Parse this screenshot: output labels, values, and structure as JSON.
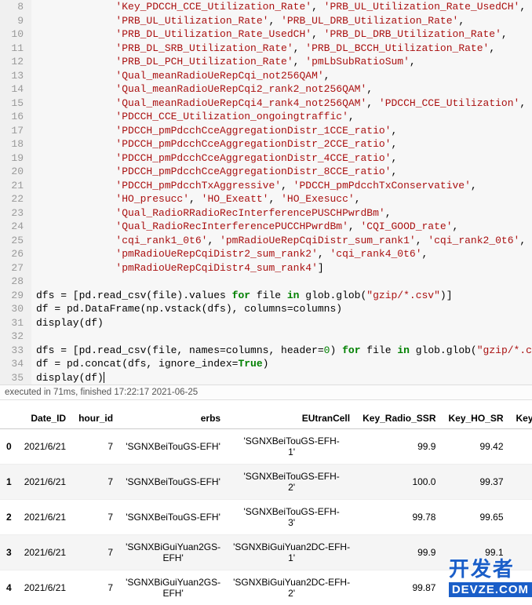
{
  "code_lines": [
    {
      "n": 8,
      "indent": "             ",
      "tokens": [
        {
          "t": "str",
          "v": "'Key_PDCCH_CCE_Utilization_Rate'"
        },
        {
          "t": "p",
          "v": ", "
        },
        {
          "t": "str",
          "v": "'PRB_UL_Utilization_Rate_UsedCH'"
        },
        {
          "t": "p",
          "v": ","
        }
      ]
    },
    {
      "n": 9,
      "indent": "             ",
      "tokens": [
        {
          "t": "str",
          "v": "'PRB_UL_Utilization_Rate'"
        },
        {
          "t": "p",
          "v": ", "
        },
        {
          "t": "str",
          "v": "'PRB_UL_DRB_Utilization_Rate'"
        },
        {
          "t": "p",
          "v": ","
        }
      ]
    },
    {
      "n": 10,
      "indent": "             ",
      "tokens": [
        {
          "t": "str",
          "v": "'PRB_DL_Utilization_Rate_UsedCH'"
        },
        {
          "t": "p",
          "v": ", "
        },
        {
          "t": "str",
          "v": "'PRB_DL_DRB_Utilization_Rate'"
        },
        {
          "t": "p",
          "v": ","
        }
      ]
    },
    {
      "n": 11,
      "indent": "             ",
      "tokens": [
        {
          "t": "str",
          "v": "'PRB_DL_SRB_Utilization_Rate'"
        },
        {
          "t": "p",
          "v": ", "
        },
        {
          "t": "str",
          "v": "'PRB_DL_BCCH_Utilization_Rate'"
        },
        {
          "t": "p",
          "v": ","
        }
      ]
    },
    {
      "n": 12,
      "indent": "             ",
      "tokens": [
        {
          "t": "str",
          "v": "'PRB_DL_PCH_Utilization_Rate'"
        },
        {
          "t": "p",
          "v": ", "
        },
        {
          "t": "str",
          "v": "'pmLbSubRatioSum'"
        },
        {
          "t": "p",
          "v": ","
        }
      ]
    },
    {
      "n": 13,
      "indent": "             ",
      "tokens": [
        {
          "t": "str",
          "v": "'Qual_meanRadioUeRepCqi_not256QAM'"
        },
        {
          "t": "p",
          "v": ","
        }
      ]
    },
    {
      "n": 14,
      "indent": "             ",
      "tokens": [
        {
          "t": "str",
          "v": "'Qual_meanRadioUeRepCqi2_rank2_not256QAM'"
        },
        {
          "t": "p",
          "v": ","
        }
      ]
    },
    {
      "n": 15,
      "indent": "             ",
      "tokens": [
        {
          "t": "str",
          "v": "'Qual_meanRadioUeRepCqi4_rank4_not256QAM'"
        },
        {
          "t": "p",
          "v": ", "
        },
        {
          "t": "str",
          "v": "'PDCCH_CCE_Utilization'"
        },
        {
          "t": "p",
          "v": ","
        }
      ]
    },
    {
      "n": 16,
      "indent": "             ",
      "tokens": [
        {
          "t": "str",
          "v": "'PDCCH_CCE_Utilization_ongoingtraffic'"
        },
        {
          "t": "p",
          "v": ","
        }
      ]
    },
    {
      "n": 17,
      "indent": "             ",
      "tokens": [
        {
          "t": "str",
          "v": "'PDCCH_pmPdcchCceAggregationDistr_1CCE_ratio'"
        },
        {
          "t": "p",
          "v": ","
        }
      ]
    },
    {
      "n": 18,
      "indent": "             ",
      "tokens": [
        {
          "t": "str",
          "v": "'PDCCH_pmPdcchCceAggregationDistr_2CCE_ratio'"
        },
        {
          "t": "p",
          "v": ","
        }
      ]
    },
    {
      "n": 19,
      "indent": "             ",
      "tokens": [
        {
          "t": "str",
          "v": "'PDCCH_pmPdcchCceAggregationDistr_4CCE_ratio'"
        },
        {
          "t": "p",
          "v": ","
        }
      ]
    },
    {
      "n": 20,
      "indent": "             ",
      "tokens": [
        {
          "t": "str",
          "v": "'PDCCH_pmPdcchCceAggregationDistr_8CCE_ratio'"
        },
        {
          "t": "p",
          "v": ","
        }
      ]
    },
    {
      "n": 21,
      "indent": "             ",
      "tokens": [
        {
          "t": "str",
          "v": "'PDCCH_pmPdcchTxAggressive'"
        },
        {
          "t": "p",
          "v": ", "
        },
        {
          "t": "str",
          "v": "'PDCCH_pmPdcchTxConservative'"
        },
        {
          "t": "p",
          "v": ","
        }
      ]
    },
    {
      "n": 22,
      "indent": "             ",
      "tokens": [
        {
          "t": "str",
          "v": "'HO_presucc'"
        },
        {
          "t": "p",
          "v": ", "
        },
        {
          "t": "str",
          "v": "'HO_Exeatt'"
        },
        {
          "t": "p",
          "v": ", "
        },
        {
          "t": "str",
          "v": "'HO_Exesucc'"
        },
        {
          "t": "p",
          "v": ","
        }
      ]
    },
    {
      "n": 23,
      "indent": "             ",
      "tokens": [
        {
          "t": "str",
          "v": "'Qual_RadioRRadioRecInterferencePUSCHPwrdBm'"
        },
        {
          "t": "p",
          "v": ","
        }
      ]
    },
    {
      "n": 24,
      "indent": "             ",
      "tokens": [
        {
          "t": "str",
          "v": "'Qual_RadioRecInterferencePUCCHPwrdBm'"
        },
        {
          "t": "p",
          "v": ", "
        },
        {
          "t": "str",
          "v": "'CQI_GOOD_rate'"
        },
        {
          "t": "p",
          "v": ","
        }
      ]
    },
    {
      "n": 25,
      "indent": "             ",
      "tokens": [
        {
          "t": "str",
          "v": "'cqi_rank1_0t6'"
        },
        {
          "t": "p",
          "v": ", "
        },
        {
          "t": "str",
          "v": "'pmRadioUeRepCqiDistr_sum_rank1'"
        },
        {
          "t": "p",
          "v": ", "
        },
        {
          "t": "str",
          "v": "'cqi_rank2_0t6'"
        },
        {
          "t": "p",
          "v": ","
        }
      ]
    },
    {
      "n": 26,
      "indent": "             ",
      "tokens": [
        {
          "t": "str",
          "v": "'pmRadioUeRepCqiDistr2_sum_rank2'"
        },
        {
          "t": "p",
          "v": ", "
        },
        {
          "t": "str",
          "v": "'cqi_rank4_0t6'"
        },
        {
          "t": "p",
          "v": ","
        }
      ]
    },
    {
      "n": 27,
      "indent": "             ",
      "tokens": [
        {
          "t": "str",
          "v": "'pmRadioUeRepCqiDistr4_sum_rank4'"
        },
        {
          "t": "p",
          "v": "]"
        }
      ]
    },
    {
      "n": 28,
      "indent": "",
      "tokens": []
    },
    {
      "n": 29,
      "indent": "",
      "tokens": [
        {
          "t": "p",
          "v": "dfs = [pd.read_csv(file).values "
        },
        {
          "t": "kw",
          "v": "for"
        },
        {
          "t": "p",
          "v": " file "
        },
        {
          "t": "kw",
          "v": "in"
        },
        {
          "t": "p",
          "v": " glob.glob("
        },
        {
          "t": "str",
          "v": "\"gzip/*.csv\""
        },
        {
          "t": "p",
          "v": ")]"
        }
      ]
    },
    {
      "n": 30,
      "indent": "",
      "tokens": [
        {
          "t": "p",
          "v": "df = pd.DataFrame(np.vstack(dfs), columns=columns)"
        }
      ]
    },
    {
      "n": 31,
      "indent": "",
      "tokens": [
        {
          "t": "p",
          "v": "display(df)"
        }
      ]
    },
    {
      "n": 32,
      "indent": "",
      "tokens": []
    },
    {
      "n": 33,
      "indent": "",
      "tokens": [
        {
          "t": "p",
          "v": "dfs = [pd.read_csv(file, names=columns, header="
        },
        {
          "t": "num",
          "v": "0"
        },
        {
          "t": "p",
          "v": ") "
        },
        {
          "t": "kw",
          "v": "for"
        },
        {
          "t": "p",
          "v": " file "
        },
        {
          "t": "kw",
          "v": "in"
        },
        {
          "t": "p",
          "v": " glob.glob("
        },
        {
          "t": "str",
          "v": "\"gzip/*.csv\""
        },
        {
          "t": "p",
          "v": ")]"
        }
      ]
    },
    {
      "n": 34,
      "indent": "",
      "tokens": [
        {
          "t": "p",
          "v": "df = pd.concat(dfs, ignore_index="
        },
        {
          "t": "bool",
          "v": "True"
        },
        {
          "t": "p",
          "v": ")"
        }
      ]
    },
    {
      "n": 35,
      "indent": "",
      "tokens": [
        {
          "t": "p",
          "v": "display(df)"
        }
      ],
      "cursor": true
    }
  ],
  "exec_status": "executed in 71ms, finished 17:22:17 2021-06-25",
  "table": {
    "headers": [
      "",
      "Date_ID",
      "hour_id",
      "erbs",
      "EUtranCell",
      "Key_Radio_SSR",
      "Key_HO_SR",
      "Key_UEC"
    ],
    "rows": [
      [
        "0",
        "2021/6/21",
        "7",
        "'SGNXBeiTouGS-EFH'",
        "'SGNXBeiTouGS-EFH-1'",
        "99.9",
        "99.42",
        ""
      ],
      [
        "1",
        "2021/6/21",
        "7",
        "'SGNXBeiTouGS-EFH'",
        "'SGNXBeiTouGS-EFH-2'",
        "100.0",
        "99.37",
        ""
      ],
      [
        "2",
        "2021/6/21",
        "7",
        "'SGNXBeiTouGS-EFH'",
        "'SGNXBeiTouGS-EFH-3'",
        "99.78",
        "99.65",
        ""
      ],
      [
        "3",
        "2021/6/21",
        "7",
        "'SGNXBiGuiYuan2GS-EFH'",
        "'SGNXBiGuiYuan2DC-EFH-1'",
        "99.9",
        "99.1",
        ""
      ],
      [
        "4",
        "2021/6/21",
        "7",
        "'SGNXBiGuiYuan2GS-EFH'",
        "'SGNXBiGuiYuan2DC-EFH-2'",
        "99.87",
        "99.03",
        ""
      ]
    ]
  },
  "watermark": {
    "top": "开发者",
    "bottom": "DEVZE.COM"
  }
}
